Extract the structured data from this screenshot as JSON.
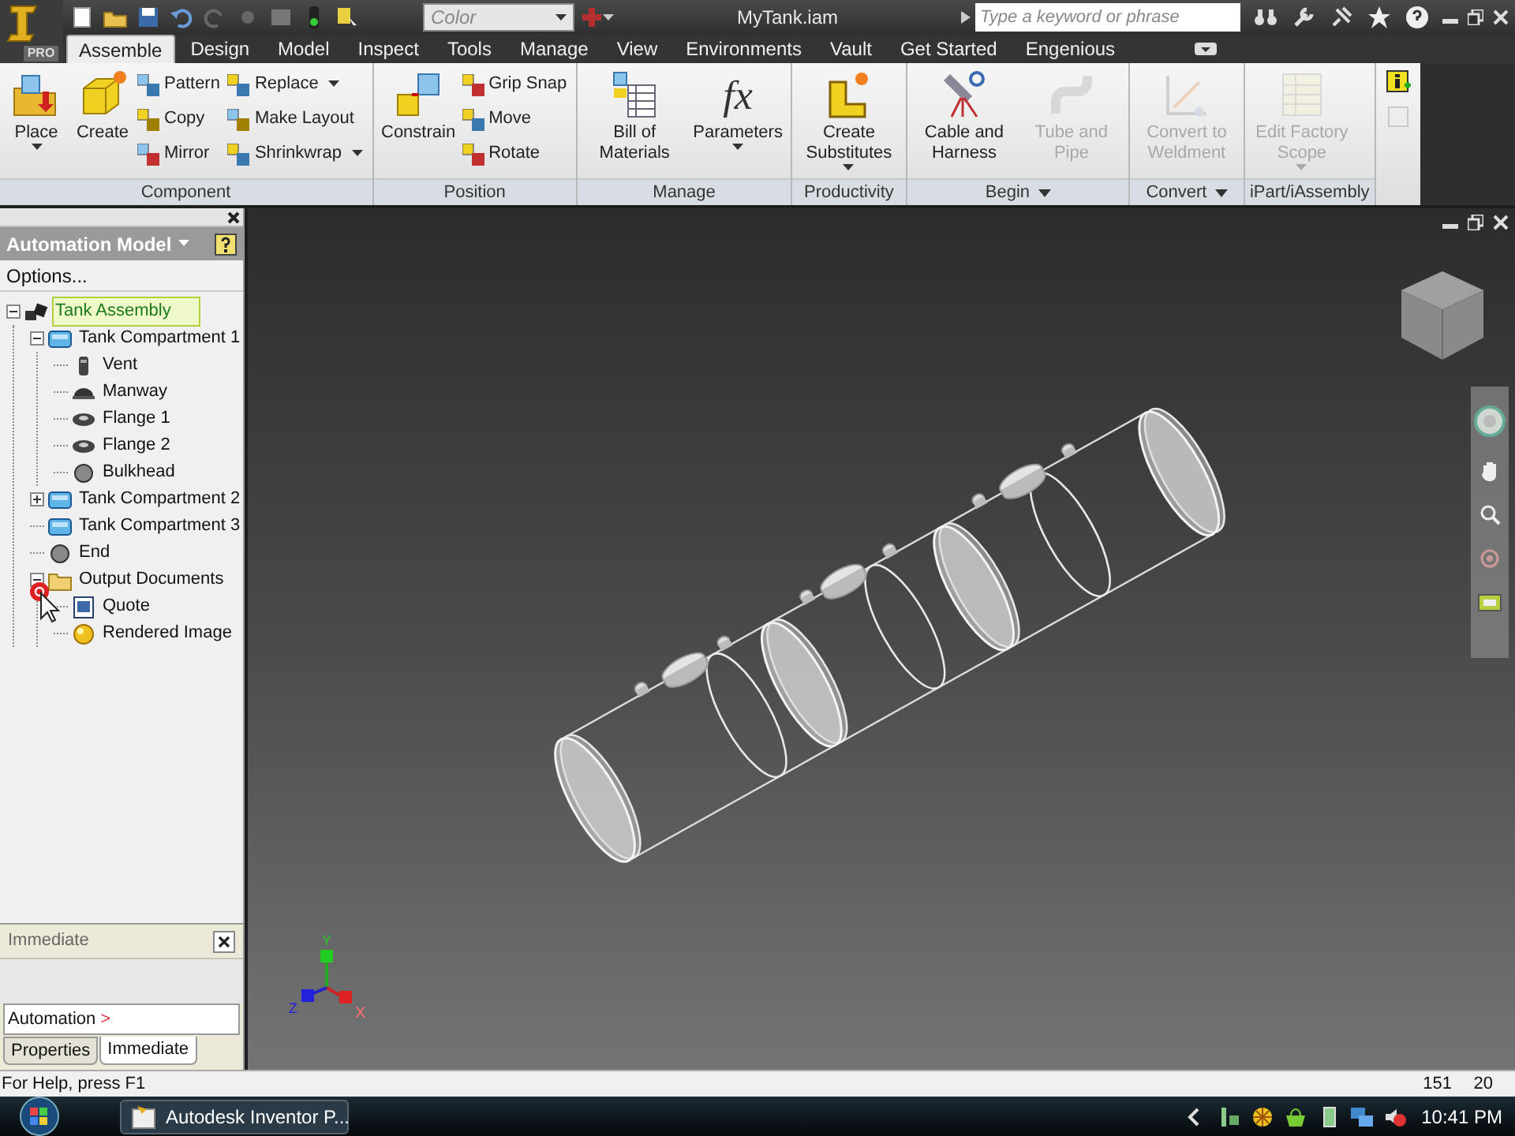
{
  "app_badge": "PRO",
  "title_bar": {
    "style_field": "Color",
    "document_title": "MyTank.iam",
    "search": {
      "placeholder": "Type a keyword or phrase"
    }
  },
  "ribbon_tabs": [
    {
      "label": "Assemble",
      "selected": true
    },
    {
      "label": "Design",
      "selected": false
    },
    {
      "label": "Model",
      "selected": false
    },
    {
      "label": "Inspect",
      "selected": false
    },
    {
      "label": "Tools",
      "selected": false
    },
    {
      "label": "Manage",
      "selected": false
    },
    {
      "label": "View",
      "selected": false
    },
    {
      "label": "Environments",
      "selected": false
    },
    {
      "label": "Vault",
      "selected": false
    },
    {
      "label": "Get Started",
      "selected": false
    },
    {
      "label": "Engenious",
      "selected": false
    }
  ],
  "ribbon_panels": [
    {
      "title": "Component",
      "menu": false,
      "tools": [
        {
          "label": "Place",
          "kind": "large",
          "dropdown": true,
          "disabled": false
        },
        {
          "label": "Create",
          "kind": "large",
          "dropdown": false,
          "disabled": false
        },
        {
          "label": "Pattern",
          "kind": "small",
          "dropdown": false,
          "disabled": false
        },
        {
          "label": "Copy",
          "kind": "small",
          "dropdown": false,
          "disabled": false
        },
        {
          "label": "Mirror",
          "kind": "small",
          "dropdown": false,
          "disabled": false
        },
        {
          "label": "Replace",
          "kind": "small",
          "dropdown": true,
          "disabled": false
        },
        {
          "label": "Make Layout",
          "kind": "small",
          "dropdown": false,
          "disabled": false
        },
        {
          "label": "Shrinkwrap",
          "kind": "small",
          "dropdown": true,
          "disabled": false
        }
      ]
    },
    {
      "title": "Position",
      "menu": false,
      "tools": [
        {
          "label": "Constrain",
          "kind": "large",
          "dropdown": false,
          "disabled": false
        },
        {
          "label": "Grip Snap",
          "kind": "small",
          "dropdown": false,
          "disabled": false
        },
        {
          "label": "Move",
          "kind": "small",
          "dropdown": false,
          "disabled": false
        },
        {
          "label": "Rotate",
          "kind": "small",
          "dropdown": false,
          "disabled": false
        }
      ]
    },
    {
      "title": "Manage",
      "menu": false,
      "tools": [
        {
          "label": "Bill of Materials",
          "kind": "large",
          "dropdown": false,
          "disabled": false
        },
        {
          "label": "Parameters",
          "kind": "large",
          "dropdown": true,
          "disabled": false,
          "glyph": "fx"
        }
      ]
    },
    {
      "title": "Productivity",
      "menu": false,
      "tools": [
        {
          "label": "Create Substitutes",
          "kind": "large",
          "dropdown": true,
          "disabled": false
        }
      ]
    },
    {
      "title": "Begin",
      "menu": true,
      "tools": [
        {
          "label": "Cable and Harness",
          "kind": "large",
          "dropdown": false,
          "disabled": false
        },
        {
          "label": "Tube and Pipe",
          "kind": "large",
          "dropdown": false,
          "disabled": true
        }
      ]
    },
    {
      "title": "Convert",
      "menu": true,
      "tools": [
        {
          "label": "Convert to Weldment",
          "kind": "large",
          "dropdown": false,
          "disabled": true
        }
      ]
    },
    {
      "title": "iPart/iAssembly",
      "menu": false,
      "tools": [
        {
          "label": "Edit Factory Scope",
          "kind": "large",
          "dropdown": true,
          "disabled": true
        }
      ]
    }
  ],
  "browser": {
    "title": "Automation Model",
    "options_label": "Options...",
    "tree": [
      {
        "label": "Tank Assembly",
        "kind": "assembly",
        "selected": true,
        "expanded": true,
        "children": [
          {
            "label": "Tank Compartment 1",
            "kind": "compartment",
            "selected": false,
            "expanded": true,
            "children": [
              {
                "label": "Vent",
                "kind": "vent",
                "selected": false
              },
              {
                "label": "Manway",
                "kind": "manway",
                "selected": false
              },
              {
                "label": "Flange 1",
                "kind": "flange",
                "selected": false
              },
              {
                "label": "Flange 2",
                "kind": "flange",
                "selected": false
              },
              {
                "label": "Bulkhead",
                "kind": "bulkhead",
                "selected": false
              }
            ]
          },
          {
            "label": "Tank Compartment 2",
            "kind": "compartment",
            "selected": false,
            "expanded": false
          },
          {
            "label": "Tank Compartment 3",
            "kind": "compartment",
            "selected": false
          },
          {
            "label": "End",
            "kind": "bulkhead",
            "selected": false
          },
          {
            "label": "Output Documents",
            "kind": "folder",
            "selected": false,
            "expanded": true,
            "children": [
              {
                "label": "Quote",
                "kind": "document",
                "selected": false
              },
              {
                "label": "Rendered Image",
                "kind": "image",
                "selected": false
              }
            ]
          }
        ]
      }
    ]
  },
  "immediate": {
    "title": "Immediate",
    "prompt": "Automation",
    "prompt_symbol": ">"
  },
  "panel_tabs": [
    {
      "label": "Properties",
      "selected": false
    },
    {
      "label": "Immediate",
      "selected": true
    }
  ],
  "viewport": {
    "axis_labels": [
      "X",
      "Y",
      "Z"
    ]
  },
  "status_bar": {
    "help": "For Help, press F1",
    "field_1": "151",
    "field_2": "20"
  },
  "taskbar": {
    "tasks": [
      {
        "label": "Autodesk Inventor P..."
      }
    ],
    "clock": "10:41 PM"
  }
}
